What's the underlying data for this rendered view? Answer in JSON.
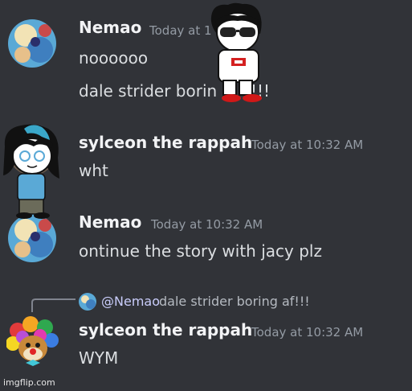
{
  "messages": [
    {
      "username": "Nemao",
      "timestamp": "Today at 1",
      "lines": [
        "noooooo",
        "dale strider borin",
        "!!!"
      ]
    },
    {
      "username": "sylceon the rappah",
      "timestamp": "Today at 10:32 AM",
      "lines": [
        "wht"
      ]
    },
    {
      "username": "Nemao",
      "timestamp": "Today at 10:32 AM",
      "lines": [
        "ontinue the story with jacy plz"
      ]
    },
    {
      "reply": {
        "mention": "@Nemao",
        "text": "dale strider boring af!!!"
      },
      "username": "sylceon the rappah",
      "timestamp": "Today at 10:32 AM",
      "lines": [
        "WYM"
      ]
    }
  ],
  "watermark": "imgflip.com",
  "colors": {
    "background": "#313338",
    "username": "#f2f3f5",
    "timestamp": "#949ba4",
    "message_text": "#dbdee1"
  }
}
